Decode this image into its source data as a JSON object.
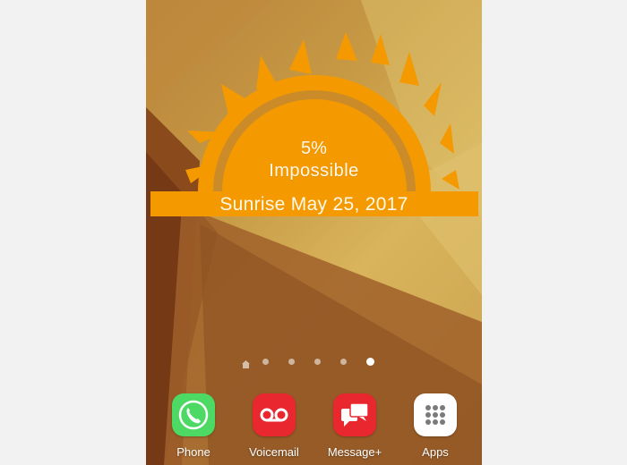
{
  "widget": {
    "percent": "5%",
    "label": "Impossible",
    "sunrise": "Sunrise May 25, 2017",
    "sun_color": "#f49a00"
  },
  "home_pages": {
    "count": 6,
    "active_index": 5
  },
  "dock": {
    "apps": [
      {
        "label": "Phone",
        "icon": "phone-icon",
        "color": "#34c759"
      },
      {
        "label": "Voicemail",
        "icon": "voicemail-icon",
        "color": "#e8282e"
      },
      {
        "label": "Message+",
        "icon": "message-icon",
        "color": "#e8282e"
      },
      {
        "label": "Apps",
        "icon": "apps-grid-icon",
        "color": "#ffffff"
      }
    ]
  }
}
